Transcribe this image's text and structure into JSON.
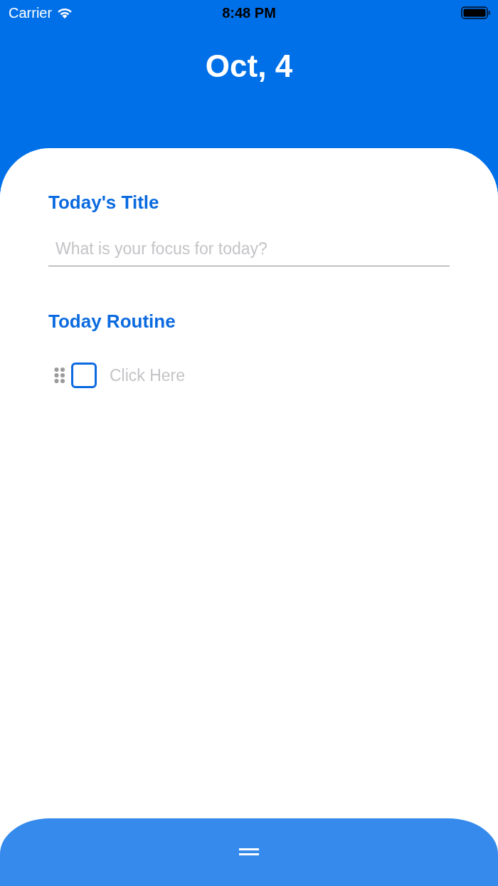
{
  "status_bar": {
    "carrier": "Carrier",
    "time": "8:48 PM"
  },
  "header": {
    "title": "Oct, 4"
  },
  "title_section": {
    "heading": "Today's Title",
    "placeholder": "What is your focus for today?"
  },
  "routine_section": {
    "heading": "Today Routine",
    "items": [
      {
        "checked": false,
        "placeholder": "Click Here"
      }
    ]
  }
}
